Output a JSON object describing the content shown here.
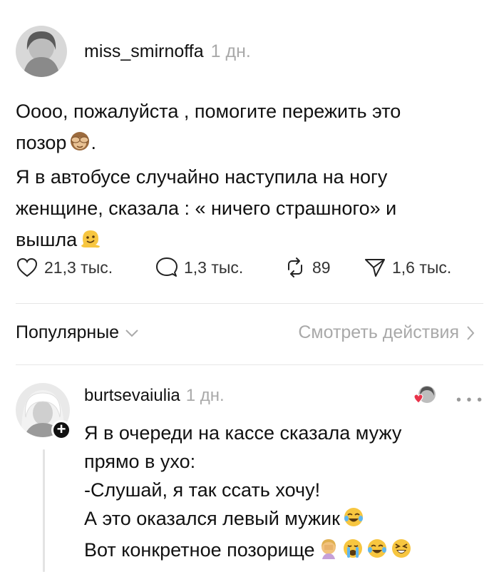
{
  "post": {
    "author": "miss_smirnoffa",
    "time": "1 дн.",
    "lines": [
      "Оооо, пожалуйста , помогите пережить это",
      "позор",
      "Я в автобусе случайно наступила на ногу",
      "женщине, сказала : « ничего страшного» и",
      "вышла"
    ],
    "emojis": [
      "see-no-evil-monkey",
      "melting-face"
    ],
    "stats": {
      "likes": "21,3 тыс.",
      "replies": "1,3 тыс.",
      "reposts": "89",
      "shares": "1,6 тыс."
    }
  },
  "sort_bar": {
    "sort_label": "Популярные",
    "activity_link": "Смотреть действия"
  },
  "comment": {
    "author": "burtsevaiulia",
    "time": "1 дн.",
    "lines": [
      "Я в очереди на кассе сказала мужу",
      "прямо в ухо:",
      "-Слушай, я так ссать хочу!",
      "А это оказался левый мужик",
      "Вот конкретное позорище"
    ],
    "emojis": [
      "tears-of-joy",
      "facepalm",
      "loudly-crying",
      "tears-of-joy",
      "laughing"
    ]
  },
  "colors": {
    "text": "#111111",
    "muted": "#a9a9a9",
    "heart": "#e8334a",
    "divider": "#e6e6e6"
  }
}
